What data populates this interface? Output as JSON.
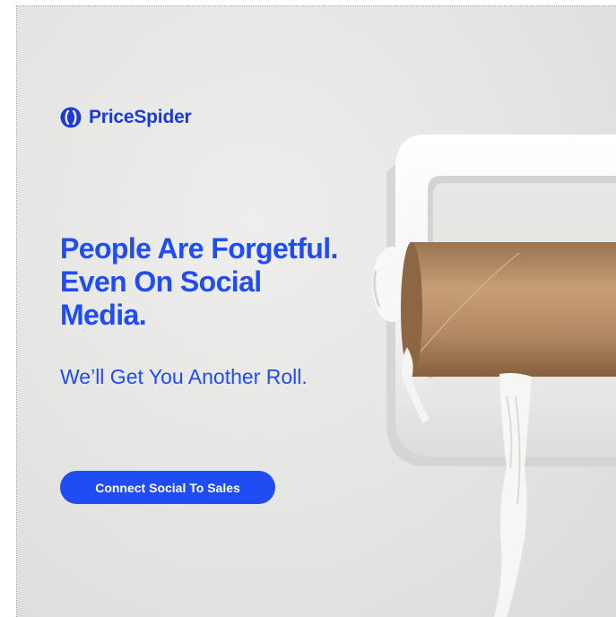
{
  "brand": {
    "name": "PriceSpider",
    "logo_icon": "pricespider-logo-icon",
    "color": "#1a3bd6"
  },
  "ad": {
    "headline": "People Are Forgetful. Even On Social Media.",
    "subheadline": "We’ll Get You Another Roll.",
    "cta_label": "Connect Social To Sales",
    "accent_color": "#1f4cf3",
    "background_image": "empty toilet paper roll on wall holder"
  }
}
